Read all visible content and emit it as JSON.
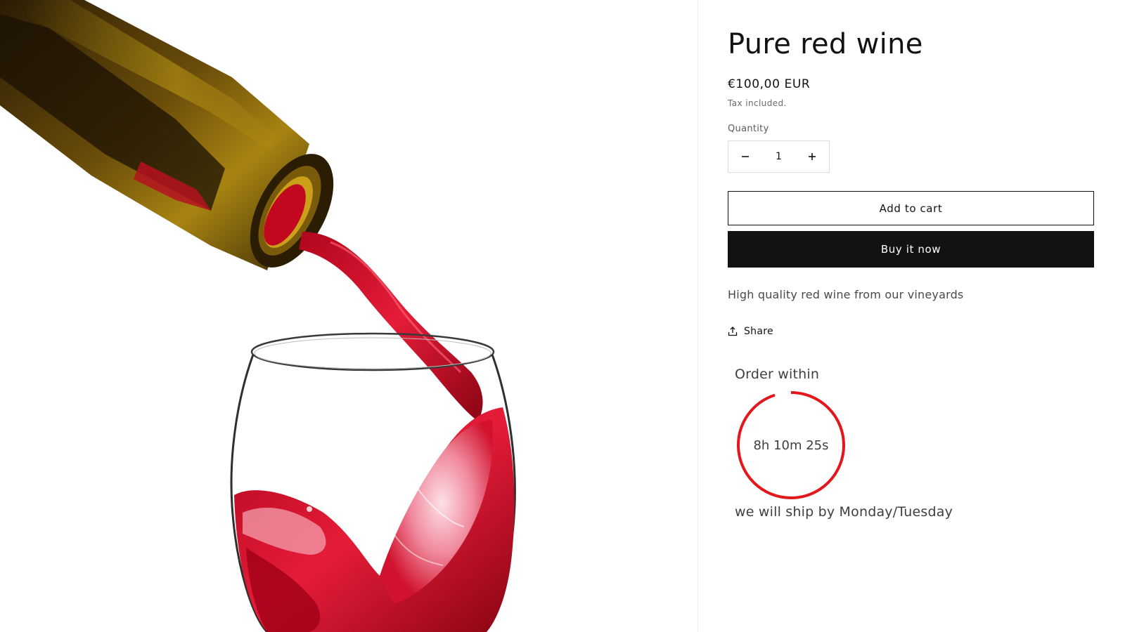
{
  "product": {
    "title": "Pure red wine",
    "price": "€100,00 EUR",
    "tax_note": "Tax included.",
    "description": "High quality red wine from our vineyards",
    "image_icon": "wine-pour-photo"
  },
  "quantity": {
    "label": "Quantity",
    "value": "1",
    "decrease_icon": "minus-icon",
    "increase_icon": "plus-icon"
  },
  "actions": {
    "add_to_cart": "Add to cart",
    "buy_now": "Buy it now"
  },
  "share": {
    "label": "Share",
    "icon": "share-upload-icon"
  },
  "countdown": {
    "heading": "Order within",
    "time_left": "8h 10m 25s",
    "shipping_note": "we will ship by Monday/Tuesday",
    "ring_progress": 0.95,
    "ring_color": "#e3161c"
  },
  "colors": {
    "text": "#121212",
    "button_dark": "#121212",
    "wine_red": "#d3112a",
    "timer_red": "#e3161c"
  }
}
